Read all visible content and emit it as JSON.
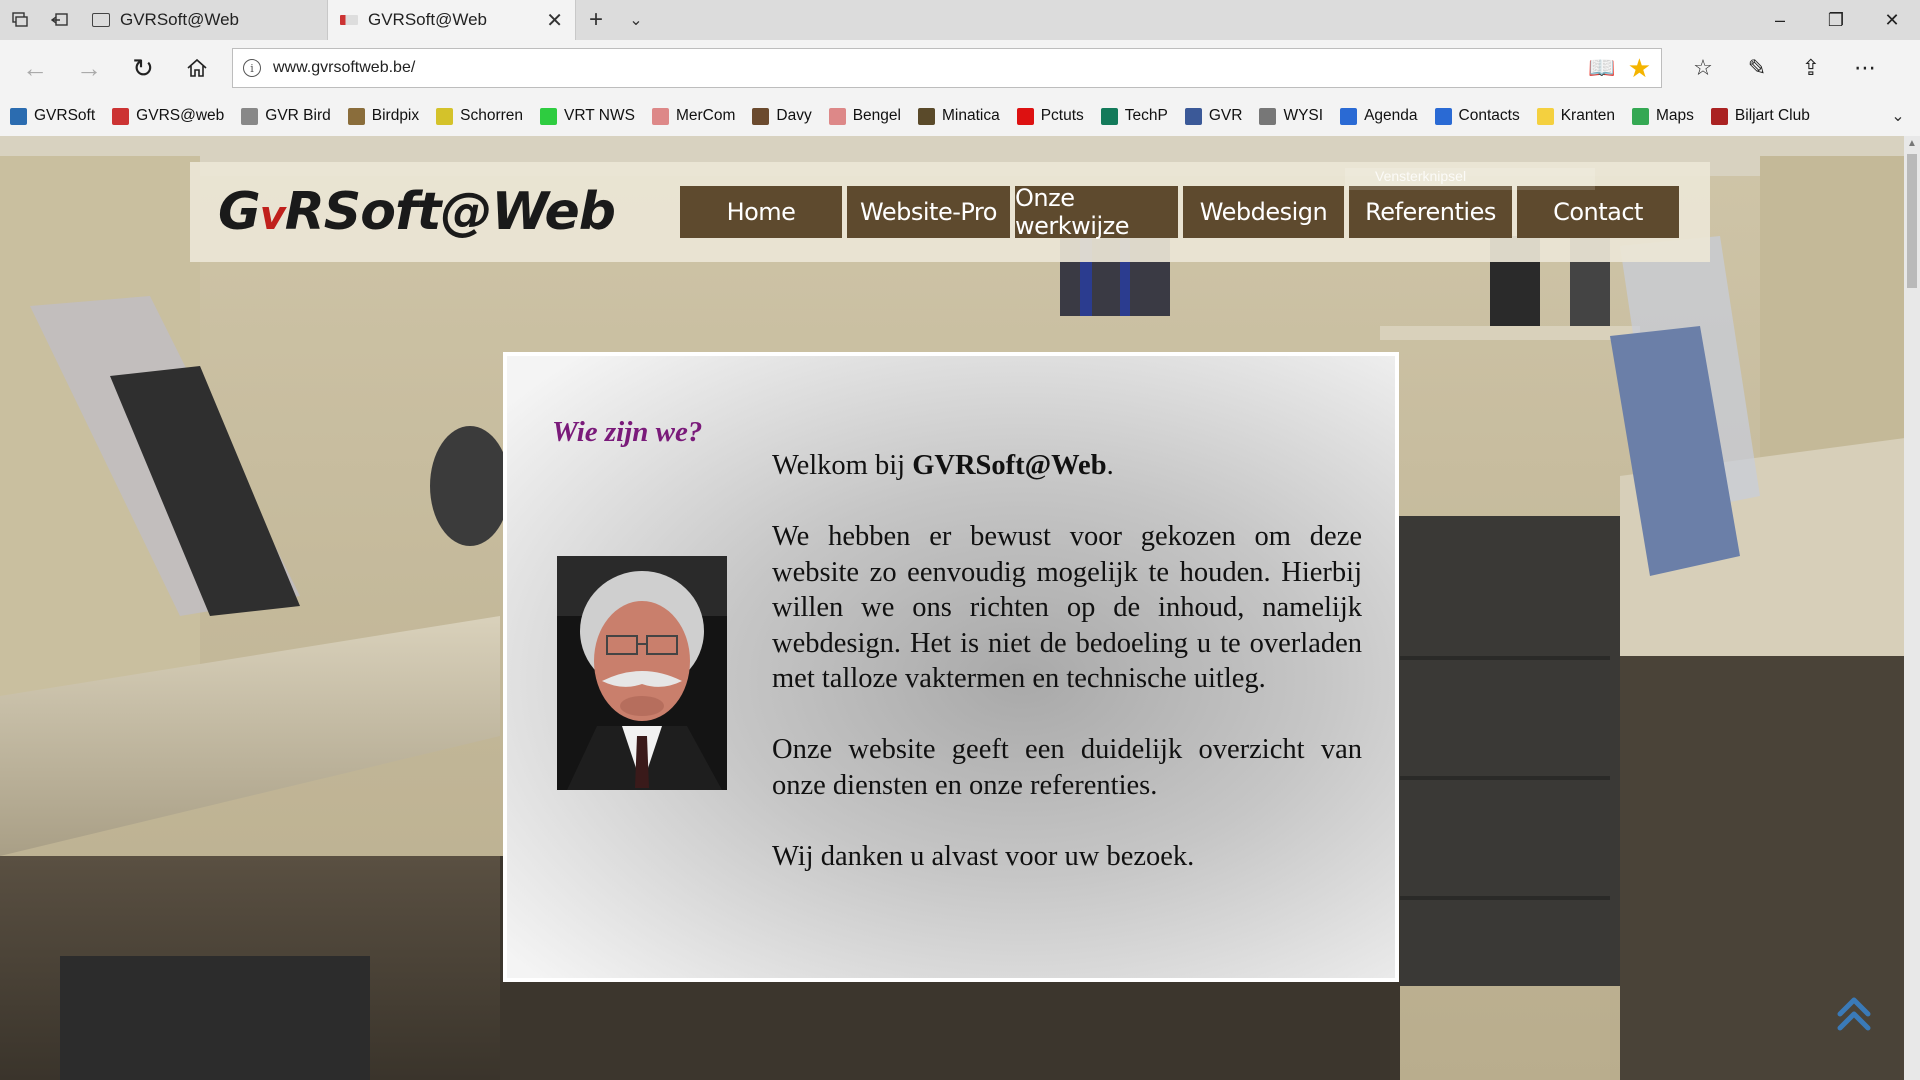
{
  "tabs": [
    {
      "title": "GVRSoft@Web",
      "active": false
    },
    {
      "title": "GVRSoft@Web",
      "active": true
    }
  ],
  "address": {
    "url": "www.gvrsoftweb.be/"
  },
  "favorites": [
    {
      "label": "GVRSoft",
      "color": "#2b6cb0"
    },
    {
      "label": "GVRS@web",
      "color": "#c33"
    },
    {
      "label": "GVR Bird",
      "color": "#888"
    },
    {
      "label": "Birdpix",
      "color": "#8a6d3b"
    },
    {
      "label": "Schorren",
      "color": "#d4c22a"
    },
    {
      "label": "VRT NWS",
      "color": "#2ecc40"
    },
    {
      "label": "MerCom",
      "color": "#d88"
    },
    {
      "label": "Davy",
      "color": "#6b4a2e"
    },
    {
      "label": "Bengel",
      "color": "#d88"
    },
    {
      "label": "Minatica",
      "color": "#5a4a2a"
    },
    {
      "label": "Pctuts",
      "color": "#d11"
    },
    {
      "label": "TechP",
      "color": "#137a5a"
    },
    {
      "label": "GVR",
      "color": "#3b5998"
    },
    {
      "label": "WYSI",
      "color": "#777"
    },
    {
      "label": "Agenda",
      "color": "#2a6ad4"
    },
    {
      "label": "Contacts",
      "color": "#2a6ad4"
    },
    {
      "label": "Kranten",
      "color": "#f4d03f"
    },
    {
      "label": "Maps",
      "color": "#34a853"
    },
    {
      "label": "Biljart Club",
      "color": "#a22"
    }
  ],
  "site": {
    "logo_pre": "G",
    "logo_v": "v",
    "logo_post": "RSoft@Web",
    "menu": [
      "Home",
      "Website-Pro",
      "Onze werkwijze",
      "Webdesign",
      "Referenties",
      "Contact"
    ],
    "snip_hint": "Vensterknipsel",
    "section_title": "Wie zijn we?",
    "welcome_pre": "Welkom bij ",
    "welcome_brand": "GVRSoft@Web",
    "welcome_post": ".",
    "paragraph_1": "We hebben er bewust voor gekozen om deze website zo eenvoudig mogelijk te houden. Hierbij willen we ons richten op de inhoud, namelijk webdesign. Het is niet de bedoeling u te overladen met talloze vaktermen en technische uitleg.",
    "paragraph_2": "Onze website geeft een duidelijk overzicht van onze diensten en onze referenties.",
    "paragraph_3": "Wij danken u alvast voor uw bezoek."
  },
  "colors": {
    "menu_bg": "#5e4a2e",
    "title_purple": "#7a1a7a",
    "logo_red": "#c0201c",
    "star": "#f4b400",
    "scroll_top_arrow": "#3a7ab8"
  }
}
